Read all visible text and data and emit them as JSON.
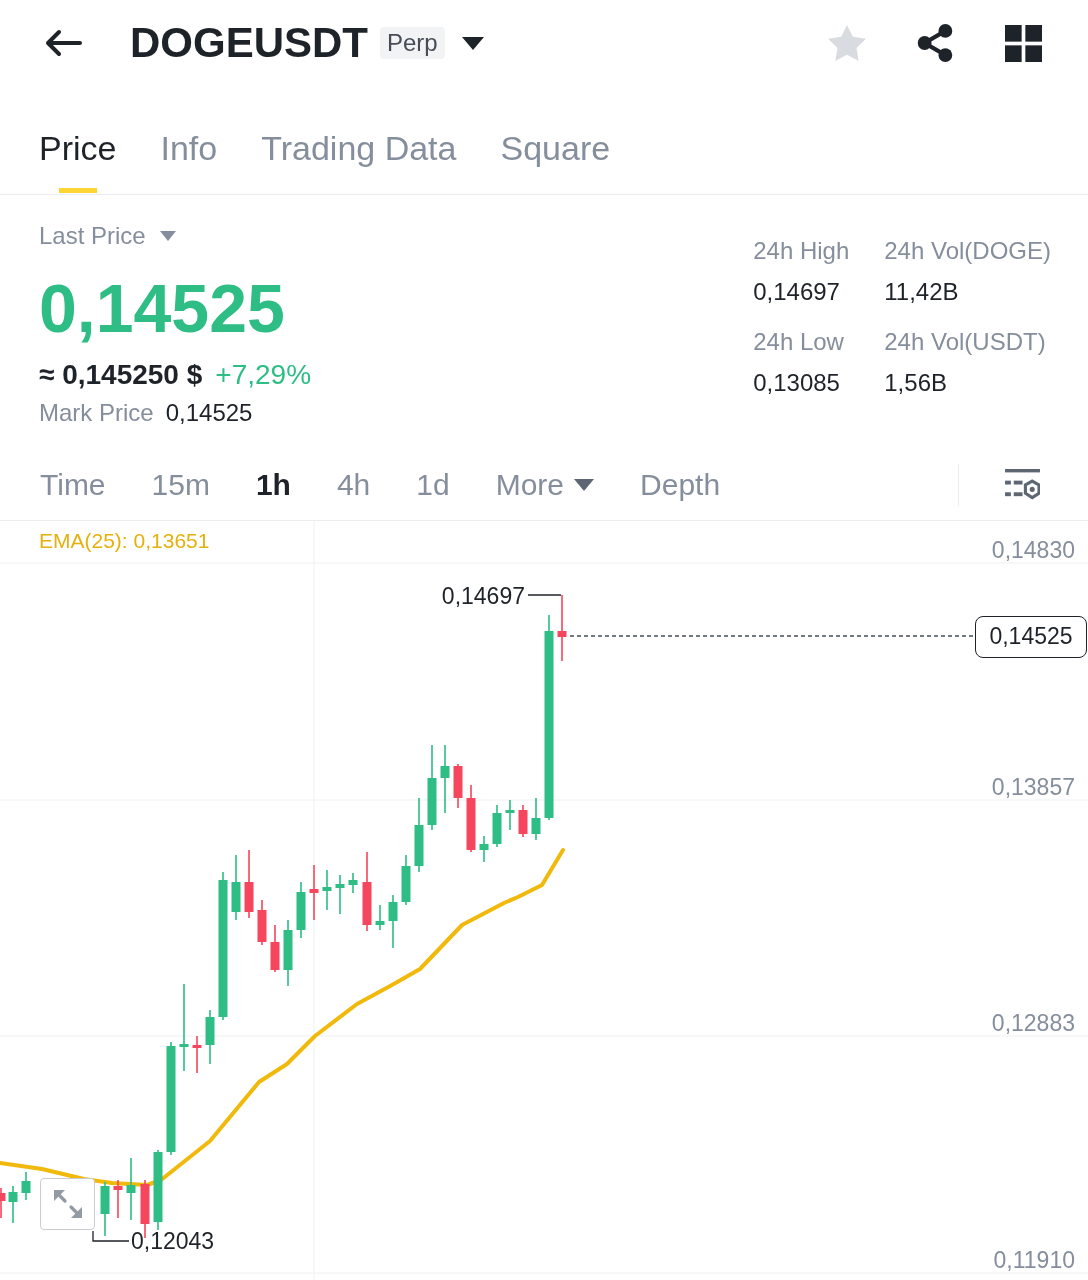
{
  "header": {
    "title": "DOGEUSDT",
    "badge": "Perp",
    "favorite": false
  },
  "tabs": [
    {
      "label": "Price",
      "selected": true
    },
    {
      "label": "Info",
      "selected": false
    },
    {
      "label": "Trading Data",
      "selected": false
    },
    {
      "label": "Square",
      "selected": false
    }
  ],
  "ticker": {
    "label": "Last Price",
    "last_price": "0,14525",
    "approx_price": "≈ 0,145250 $",
    "change": "+7,29%",
    "mark_price_label": "Mark Price",
    "mark_price": "0,14525"
  },
  "stats": [
    {
      "label": "24h High",
      "value": "0,14697"
    },
    {
      "label": "24h Vol(DOGE)",
      "value": "11,42B"
    },
    {
      "label": "24h Low",
      "value": "0,13085"
    },
    {
      "label": "24h Vol(USDT)",
      "value": "1,56B"
    }
  ],
  "intervals": [
    {
      "label": "Time",
      "selected": false,
      "kind": "option"
    },
    {
      "label": "15m",
      "selected": false,
      "kind": "option"
    },
    {
      "label": "1h",
      "selected": true,
      "kind": "option"
    },
    {
      "label": "4h",
      "selected": false,
      "kind": "option"
    },
    {
      "label": "1d",
      "selected": false,
      "kind": "option"
    },
    {
      "label": "More",
      "selected": false,
      "kind": "dropdown"
    },
    {
      "label": "Depth",
      "selected": false,
      "kind": "option"
    }
  ],
  "chart": {
    "indicator": "EMA(25): 0,13651",
    "price_axis": [
      "0,14830",
      "0,13857",
      "0,12883",
      "0,11910"
    ],
    "high_label": "0,14697",
    "low_label": "0,12043",
    "last_price_tag": "0,14525"
  }
}
